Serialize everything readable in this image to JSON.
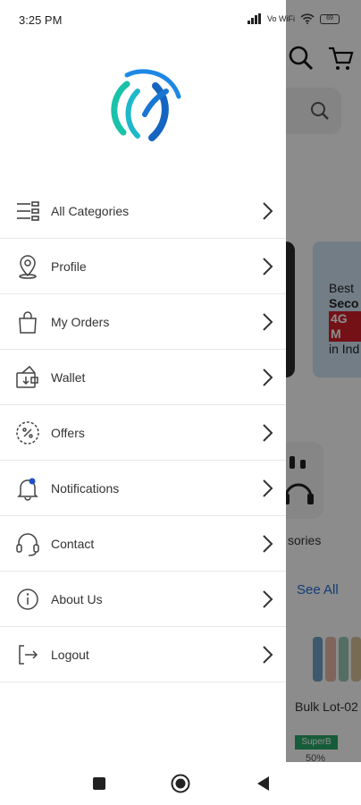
{
  "status_bar": {
    "time": "3:25 PM",
    "network_label": "Vo WiFi",
    "battery": "69"
  },
  "drawer": {
    "menu": [
      {
        "label": "All Categories",
        "icon": "categories-icon"
      },
      {
        "label": "Profile",
        "icon": "profile-icon"
      },
      {
        "label": "My Orders",
        "icon": "shopping-bag-icon"
      },
      {
        "label": "Wallet",
        "icon": "wallet-icon"
      },
      {
        "label": "Offers",
        "icon": "offers-icon"
      },
      {
        "label": "Notifications",
        "icon": "bell-icon"
      },
      {
        "label": "Contact",
        "icon": "headset-icon"
      },
      {
        "label": "About Us",
        "icon": "info-icon"
      },
      {
        "label": "Logout",
        "icon": "logout-icon"
      }
    ]
  },
  "background": {
    "banner_line1": "Best",
    "banner_line2": "Seco",
    "banner_line3": "4G M",
    "banner_line4": "in Ind",
    "category_label": "sories",
    "see_all": "See All",
    "product_title": "Bulk Lot-02",
    "product_badge": "SuperB",
    "product_discount": "50%"
  },
  "colors": {
    "accent_blue": "#1f6fd6",
    "logo_teal": "#19c2a8",
    "logo_blue": "#1565c0",
    "scrim": "rgba(0,0,0,0.45)"
  }
}
